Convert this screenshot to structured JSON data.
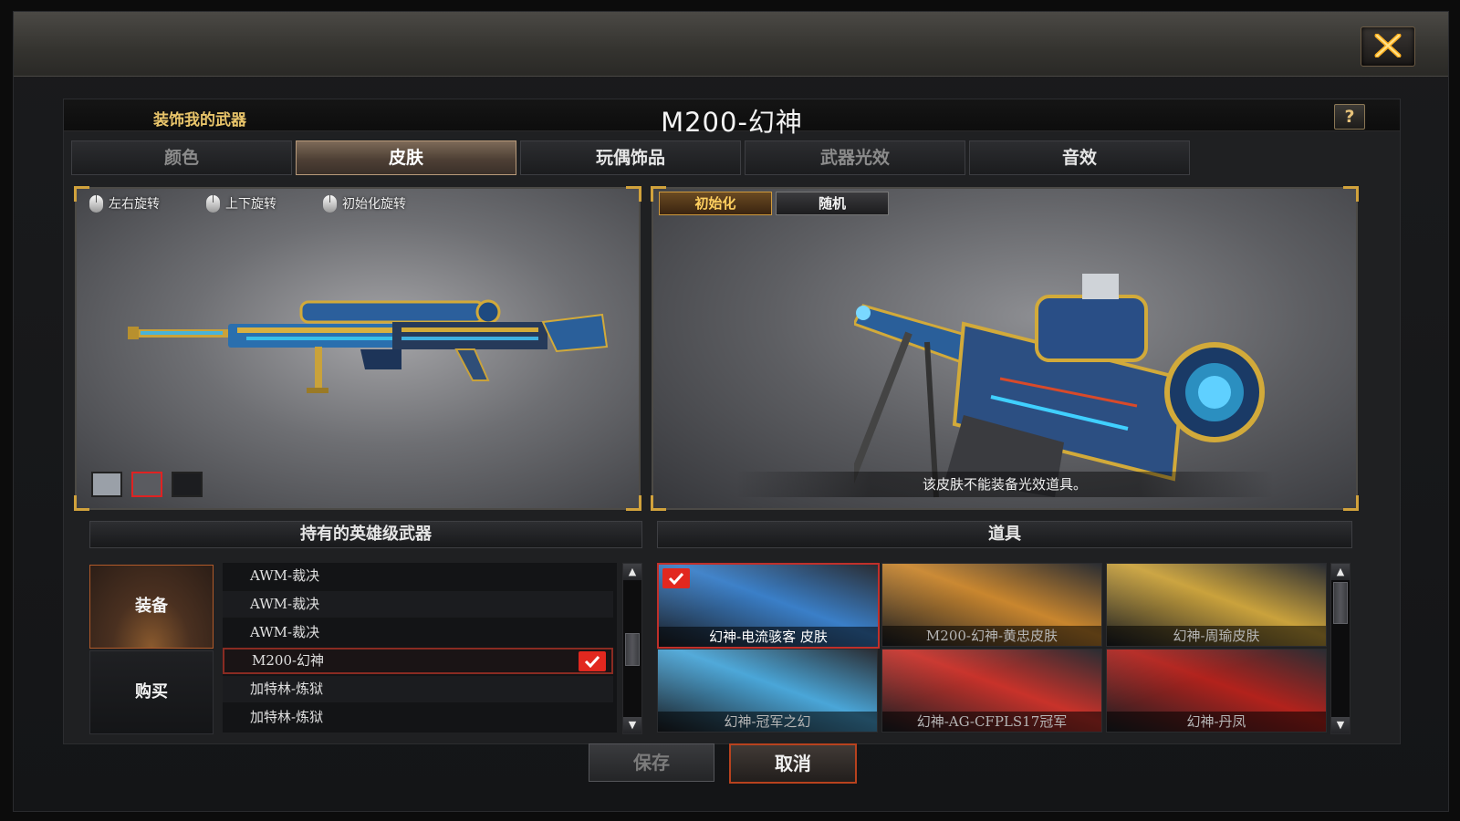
{
  "window": {
    "close_icon": "close-x-icon",
    "header": {
      "section_title": "装饰我的武器",
      "weapon_name": "M200-幻神",
      "help_label": "?"
    },
    "tabs": [
      {
        "label": "颜色",
        "state": "normal"
      },
      {
        "label": "皮肤",
        "state": "active"
      },
      {
        "label": "玩偶饰品",
        "state": "normal"
      },
      {
        "label": "武器光效",
        "state": "normal"
      },
      {
        "label": "音效",
        "state": "normal"
      }
    ],
    "preview_left": {
      "rotate_controls": [
        {
          "label": "左右旋转",
          "icon": "mouse-icon"
        },
        {
          "label": "上下旋转",
          "icon": "mouse-icon"
        },
        {
          "label": "初始化旋转",
          "icon": "mouse-icon"
        }
      ],
      "backgrounds": [
        {
          "color": "#9aa0a8",
          "selected": false
        },
        {
          "color": "#5a5b60",
          "selected": true
        },
        {
          "color": "#1c1d20",
          "selected": false
        }
      ]
    },
    "preview_right": {
      "reset_label": "初始化",
      "random_label": "随机",
      "notice": "该皮肤不能装备光效道具。"
    },
    "weapon_list": {
      "title": "持有的英雄级武器",
      "equip_label": "装备",
      "buy_label": "购买",
      "rows": [
        {
          "name": "AWM-裁决",
          "selected": false
        },
        {
          "name": "AWM-裁决",
          "selected": false
        },
        {
          "name": "AWM-裁决",
          "selected": false
        },
        {
          "name": "M200-幻神",
          "selected": true
        },
        {
          "name": "加特林-炼狱",
          "selected": false
        },
        {
          "name": "加特林-炼狱",
          "selected": false
        }
      ]
    },
    "items": {
      "title": "道具",
      "list": [
        {
          "name": "幻神-电流骇客 皮肤",
          "selected": true,
          "accent": "#3a7fc8"
        },
        {
          "name": "M200-幻神-黄忠皮肤",
          "selected": false,
          "accent": "#c9862e"
        },
        {
          "name": "幻神-周瑜皮肤",
          "selected": false,
          "accent": "#caa23c"
        },
        {
          "name": "幻神-冠军之幻",
          "selected": false,
          "accent": "#4aa6d8"
        },
        {
          "name": "幻神-AG-CFPLS17冠军",
          "selected": false,
          "accent": "#c8322a"
        },
        {
          "name": "幻神-丹凤",
          "selected": false,
          "accent": "#b2221c"
        }
      ]
    },
    "footer": {
      "save_label": "保存",
      "cancel_label": "取消"
    },
    "colors": {
      "accent_gold": "#d1a23c",
      "selected_red": "#e2281f"
    }
  }
}
